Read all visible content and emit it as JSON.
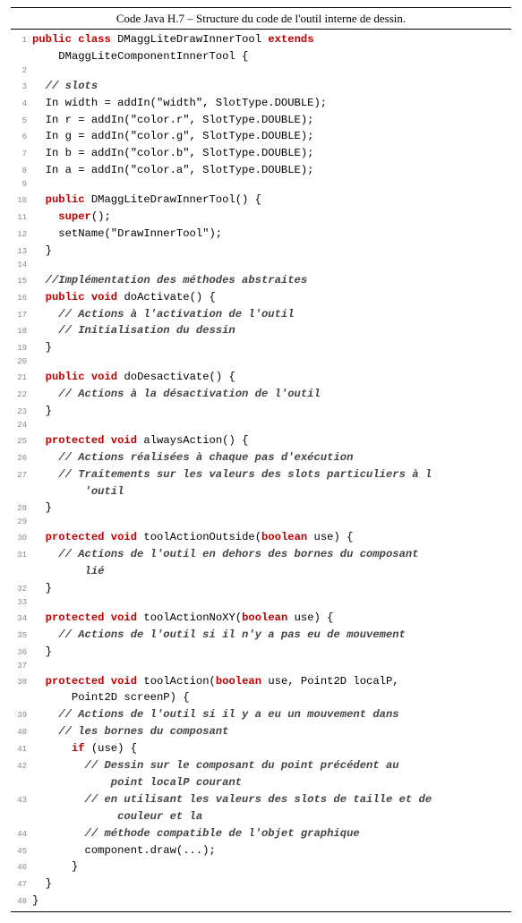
{
  "caption": "Code Java H.7 – Structure du code de l'outil interne de dessin.",
  "lines": [
    {
      "n": 1,
      "segs": [
        {
          "t": "public",
          "c": "kw"
        },
        {
          "t": " "
        },
        {
          "t": "class",
          "c": "kw"
        },
        {
          "t": " DMaggLiteDrawInnerTool "
        },
        {
          "t": "extends",
          "c": "kw"
        }
      ]
    },
    {
      "n": "",
      "segs": [
        {
          "t": "    DMaggLiteComponentInnerTool {"
        }
      ]
    },
    {
      "n": 2,
      "segs": [
        {
          "t": ""
        }
      ]
    },
    {
      "n": 3,
      "segs": [
        {
          "t": "  "
        },
        {
          "t": "// slots",
          "c": "cm"
        }
      ]
    },
    {
      "n": 4,
      "segs": [
        {
          "t": "  In width = addIn(\"width\", SlotType.DOUBLE);"
        }
      ]
    },
    {
      "n": 5,
      "segs": [
        {
          "t": "  In r = addIn(\"color.r\", SlotType.DOUBLE);"
        }
      ]
    },
    {
      "n": 6,
      "segs": [
        {
          "t": "  In g = addIn(\"color.g\", SlotType.DOUBLE);"
        }
      ]
    },
    {
      "n": 7,
      "segs": [
        {
          "t": "  In b = addIn(\"color.b\", SlotType.DOUBLE);"
        }
      ]
    },
    {
      "n": 8,
      "segs": [
        {
          "t": "  In a = addIn(\"color.a\", SlotType.DOUBLE);"
        }
      ]
    },
    {
      "n": 9,
      "segs": [
        {
          "t": ""
        }
      ]
    },
    {
      "n": 10,
      "segs": [
        {
          "t": "  "
        },
        {
          "t": "public",
          "c": "kw"
        },
        {
          "t": " DMaggLiteDrawInnerTool() {"
        }
      ]
    },
    {
      "n": 11,
      "segs": [
        {
          "t": "    "
        },
        {
          "t": "super",
          "c": "kw"
        },
        {
          "t": "();"
        }
      ]
    },
    {
      "n": 12,
      "segs": [
        {
          "t": "    setName(\"DrawInnerTool\");"
        }
      ]
    },
    {
      "n": 13,
      "segs": [
        {
          "t": "  }"
        }
      ]
    },
    {
      "n": 14,
      "segs": [
        {
          "t": ""
        }
      ]
    },
    {
      "n": 15,
      "segs": [
        {
          "t": "  "
        },
        {
          "t": "//Implémentation des méthodes abstraites",
          "c": "cm"
        }
      ]
    },
    {
      "n": 16,
      "segs": [
        {
          "t": "  "
        },
        {
          "t": "public",
          "c": "kw"
        },
        {
          "t": " "
        },
        {
          "t": "void",
          "c": "kw"
        },
        {
          "t": " doActivate() {"
        }
      ]
    },
    {
      "n": 17,
      "segs": [
        {
          "t": "    "
        },
        {
          "t": "// Actions à l'activation de l'outil",
          "c": "cm"
        }
      ]
    },
    {
      "n": 18,
      "segs": [
        {
          "t": "    "
        },
        {
          "t": "// Initialisation du dessin",
          "c": "cm"
        }
      ]
    },
    {
      "n": 19,
      "segs": [
        {
          "t": "  }"
        }
      ]
    },
    {
      "n": 20,
      "segs": [
        {
          "t": ""
        }
      ]
    },
    {
      "n": 21,
      "segs": [
        {
          "t": "  "
        },
        {
          "t": "public",
          "c": "kw"
        },
        {
          "t": " "
        },
        {
          "t": "void",
          "c": "kw"
        },
        {
          "t": " doDesactivate() {"
        }
      ]
    },
    {
      "n": 22,
      "segs": [
        {
          "t": "    "
        },
        {
          "t": "// Actions à la désactivation de l'outil",
          "c": "cm"
        }
      ]
    },
    {
      "n": 23,
      "segs": [
        {
          "t": "  }"
        }
      ]
    },
    {
      "n": 24,
      "segs": [
        {
          "t": ""
        }
      ]
    },
    {
      "n": 25,
      "segs": [
        {
          "t": "  "
        },
        {
          "t": "protected",
          "c": "kw"
        },
        {
          "t": " "
        },
        {
          "t": "void",
          "c": "kw"
        },
        {
          "t": " alwaysAction() {"
        }
      ]
    },
    {
      "n": 26,
      "segs": [
        {
          "t": "    "
        },
        {
          "t": "// Actions réalisées à chaque pas d'exécution",
          "c": "cm"
        }
      ]
    },
    {
      "n": 27,
      "segs": [
        {
          "t": "    "
        },
        {
          "t": "// Traitements sur les valeurs des slots particuliers à l",
          "c": "cm"
        }
      ]
    },
    {
      "n": "",
      "segs": [
        {
          "t": "        "
        },
        {
          "t": "'outil",
          "c": "cm"
        }
      ]
    },
    {
      "n": 28,
      "segs": [
        {
          "t": "  }"
        }
      ]
    },
    {
      "n": 29,
      "segs": [
        {
          "t": ""
        }
      ]
    },
    {
      "n": 30,
      "segs": [
        {
          "t": "  "
        },
        {
          "t": "protected",
          "c": "kw"
        },
        {
          "t": " "
        },
        {
          "t": "void",
          "c": "kw"
        },
        {
          "t": " toolActionOutside("
        },
        {
          "t": "boolean",
          "c": "kw"
        },
        {
          "t": " use) {"
        }
      ]
    },
    {
      "n": 31,
      "segs": [
        {
          "t": "    "
        },
        {
          "t": "// Actions de l'outil en dehors des bornes du composant",
          "c": "cm"
        }
      ]
    },
    {
      "n": "",
      "segs": [
        {
          "t": "        "
        },
        {
          "t": "lié",
          "c": "cm"
        }
      ]
    },
    {
      "n": 32,
      "segs": [
        {
          "t": "  }"
        }
      ]
    },
    {
      "n": 33,
      "segs": [
        {
          "t": ""
        }
      ]
    },
    {
      "n": 34,
      "segs": [
        {
          "t": "  "
        },
        {
          "t": "protected",
          "c": "kw"
        },
        {
          "t": " "
        },
        {
          "t": "void",
          "c": "kw"
        },
        {
          "t": " toolActionNoXY("
        },
        {
          "t": "boolean",
          "c": "kw"
        },
        {
          "t": " use) {"
        }
      ]
    },
    {
      "n": 35,
      "segs": [
        {
          "t": "    "
        },
        {
          "t": "// Actions de l'outil si il n'y a pas eu de mouvement",
          "c": "cm"
        }
      ]
    },
    {
      "n": 36,
      "segs": [
        {
          "t": "  }"
        }
      ]
    },
    {
      "n": 37,
      "segs": [
        {
          "t": ""
        }
      ]
    },
    {
      "n": 38,
      "segs": [
        {
          "t": "  "
        },
        {
          "t": "protected",
          "c": "kw"
        },
        {
          "t": " "
        },
        {
          "t": "void",
          "c": "kw"
        },
        {
          "t": " toolAction("
        },
        {
          "t": "boolean",
          "c": "kw"
        },
        {
          "t": " use, Point2D localP,"
        }
      ]
    },
    {
      "n": "",
      "segs": [
        {
          "t": "      Point2D screenP) {"
        }
      ]
    },
    {
      "n": 39,
      "segs": [
        {
          "t": "    "
        },
        {
          "t": "// Actions de l'outil si il y a eu un mouvement dans",
          "c": "cm"
        }
      ]
    },
    {
      "n": 40,
      "segs": [
        {
          "t": "    "
        },
        {
          "t": "// les bornes du composant",
          "c": "cm"
        }
      ]
    },
    {
      "n": 41,
      "segs": [
        {
          "t": "      "
        },
        {
          "t": "if",
          "c": "kw"
        },
        {
          "t": " (use) {"
        }
      ]
    },
    {
      "n": 42,
      "segs": [
        {
          "t": "        "
        },
        {
          "t": "// Dessin sur le composant du point précédent au",
          "c": "cm"
        }
      ]
    },
    {
      "n": "",
      "segs": [
        {
          "t": "            "
        },
        {
          "t": "point localP courant",
          "c": "cm"
        }
      ]
    },
    {
      "n": 43,
      "segs": [
        {
          "t": "        "
        },
        {
          "t": "// en utilisant les valeurs des slots de taille et de",
          "c": "cm"
        }
      ]
    },
    {
      "n": "",
      "segs": [
        {
          "t": "             "
        },
        {
          "t": "couleur et la",
          "c": "cm"
        }
      ]
    },
    {
      "n": 44,
      "segs": [
        {
          "t": "        "
        },
        {
          "t": "// méthode compatible de l'objet graphique",
          "c": "cm"
        }
      ]
    },
    {
      "n": 45,
      "segs": [
        {
          "t": "        component.draw(...);"
        }
      ]
    },
    {
      "n": 46,
      "segs": [
        {
          "t": "      }"
        }
      ]
    },
    {
      "n": 47,
      "segs": [
        {
          "t": "  }"
        }
      ]
    },
    {
      "n": 48,
      "segs": [
        {
          "t": "}"
        }
      ]
    }
  ]
}
